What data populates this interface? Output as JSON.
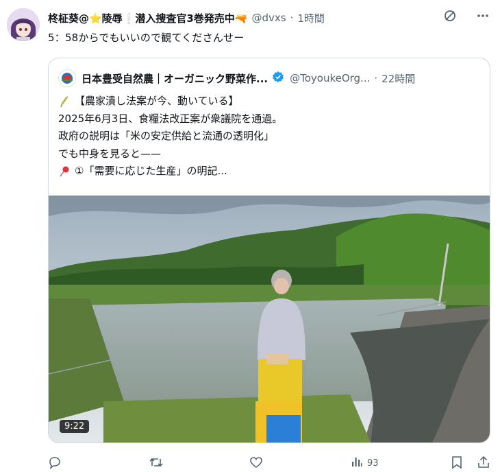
{
  "post": {
    "author_name": "柊柾葵@⭐陵辱❕潜入捜査官3巻発売中🔫",
    "handle": "@dvxs",
    "separator": "·",
    "time": "1時間",
    "text": "5：58からでもいいので観てくださんせー"
  },
  "quote": {
    "author_name": "日本豊受自然農｜オーガニック野菜作...",
    "handle": "@ToyoukeOrg...",
    "separator": "·",
    "time": "22時間",
    "lines": [
      "【農家潰し法案が今、動いている】",
      "2025年6月3日、食糧法改正案が衆議院を通過。",
      "政府の説明は「米の安定供給と流通の透明化」",
      "でも中身を見ると——",
      "①「需要に応じた生産」の明記..."
    ],
    "media": {
      "duration": "9:22"
    }
  },
  "actions": {
    "views": "93"
  },
  "icons": {
    "grok": "grok-icon",
    "more": "more-icon",
    "reply": "reply-icon",
    "repost": "repost-icon",
    "like": "like-icon",
    "views": "views-icon",
    "bookmark": "bookmark-icon",
    "share": "share-icon"
  },
  "colors": {
    "text": "#0f1419",
    "secondary": "#536471",
    "border": "#cfd9de",
    "verified": "#1d9bf0"
  }
}
